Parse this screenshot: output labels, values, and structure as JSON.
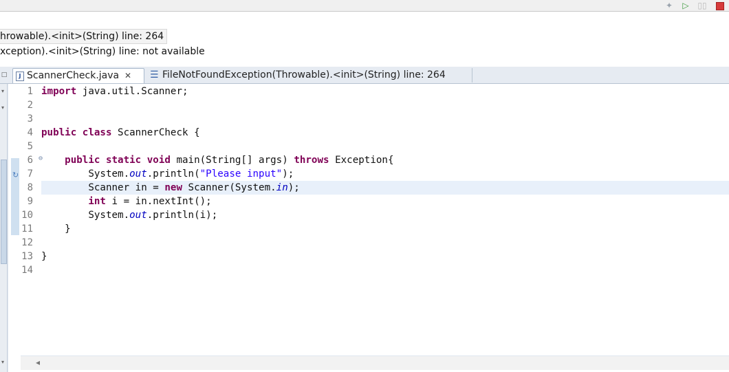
{
  "toolbar": {
    "icons": [
      "tools-icon",
      "resume-icon",
      "suspend-icon",
      "terminate-icon"
    ]
  },
  "debug_stack": {
    "frames": [
      "hrowable).<init>(String) line: 264",
      "xception).<init>(String) line: not available"
    ]
  },
  "editor": {
    "tabs": [
      {
        "label": "ScannerCheck.java",
        "close": "✕"
      },
      {
        "label": "FileNotFoundException(Throwable).<init>(String) line: 264"
      }
    ],
    "line_numbers": [
      "1",
      "2",
      "3",
      "4",
      "5",
      "6",
      "7",
      "8",
      "9",
      "10",
      "11",
      "12",
      "13",
      "14"
    ],
    "current_line": 8
  },
  "colors": {
    "keyword": "#7f0055",
    "string": "#2a00ff",
    "static_field": "#0000c0",
    "current_line_bg": "#e8f0fa"
  }
}
